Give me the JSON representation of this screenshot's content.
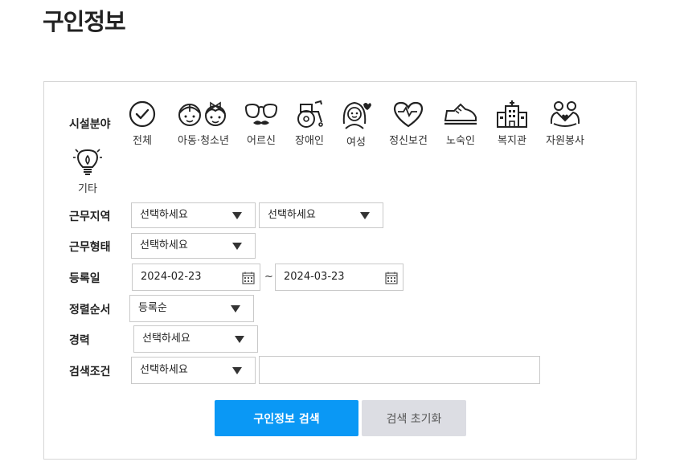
{
  "page": {
    "title": "구인정보"
  },
  "filters": {
    "facility_label": "시설분야",
    "categories": [
      {
        "label": "전체",
        "icon": "check-circle-icon"
      },
      {
        "label": "아동·청소년",
        "icon": "children-icon"
      },
      {
        "label": "어르신",
        "icon": "elder-glasses-icon"
      },
      {
        "label": "장애인",
        "icon": "wheelchair-icon"
      },
      {
        "label": "여성",
        "icon": "woman-icon"
      },
      {
        "label": "정신보건",
        "icon": "heart-icon"
      },
      {
        "label": "노숙인",
        "icon": "shoe-icon"
      },
      {
        "label": "복지관",
        "icon": "building-icon"
      },
      {
        "label": "자원봉사",
        "icon": "volunteer-hands-icon"
      },
      {
        "label": "기타",
        "icon": "lightbulb-icon"
      }
    ],
    "region_label": "근무지역",
    "region_select_1": "선택하세요",
    "region_select_2": "선택하세요",
    "worktype_label": "근무형태",
    "worktype_select": "선택하세요",
    "date_label": "등록일",
    "date_start": "2024-02-23",
    "date_separator": "~",
    "date_end": "2024-03-23",
    "sort_label": "정렬순서",
    "sort_select": "등록순",
    "career_label": "경력",
    "career_select": "선택하세요",
    "search_label": "검색조건",
    "search_select": "선택하세요",
    "search_input_value": ""
  },
  "buttons": {
    "search": "구인정보 검색",
    "reset": "검색 초기화"
  }
}
